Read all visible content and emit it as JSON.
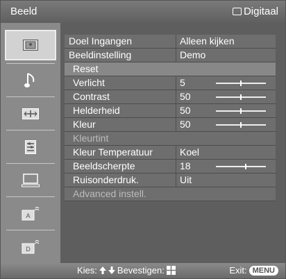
{
  "header": {
    "title": "Beeld",
    "input_label": "Digitaal",
    "input_icon": "tv-input-icon"
  },
  "sidebar": {
    "items": [
      {
        "icon": "picture-icon",
        "selected": true
      },
      {
        "icon": "music-note-icon"
      },
      {
        "icon": "screen-format-icon"
      },
      {
        "icon": "setup-list-icon"
      },
      {
        "icon": "monitor-pc-icon"
      },
      {
        "icon": "analog-setup-icon"
      },
      {
        "icon": "digital-setup-icon"
      }
    ]
  },
  "menu": {
    "rows": [
      {
        "label": "Doel Ingangen",
        "value": "Alleen kijken",
        "level": 0,
        "highlight": false
      },
      {
        "label": "Beeldinstelling",
        "value": "Demo",
        "level": 0,
        "highlight": false
      },
      {
        "label": "Reset",
        "value": "",
        "level": 1,
        "highlight": true
      },
      {
        "label": "Verlicht",
        "value": "5",
        "level": 1,
        "highlight": false,
        "slider": 0.5
      },
      {
        "label": "Contrast",
        "value": "50",
        "level": 1,
        "highlight": false,
        "slider": 0.5
      },
      {
        "label": "Helderheid",
        "value": "50",
        "level": 1,
        "highlight": false,
        "slider": 0.5
      },
      {
        "label": "Kleur",
        "value": "50",
        "level": 1,
        "highlight": false,
        "slider": 0.5
      },
      {
        "label": "Kleurtint",
        "value": "",
        "level": 1,
        "highlight": false,
        "disabled": true
      },
      {
        "label": "Kleur Temperatuur",
        "value": "Koel",
        "level": 1,
        "highlight": false
      },
      {
        "label": "Beeldscherpte",
        "value": "18",
        "level": 1,
        "highlight": false,
        "slider": 0.6
      },
      {
        "label": "Ruisonderdruk.",
        "value": "Uit",
        "level": 1,
        "highlight": false
      },
      {
        "label": "Advanced instell.",
        "value": "",
        "level": 1,
        "highlight": false,
        "disabled": true
      }
    ]
  },
  "footer": {
    "select_label": "Kies:",
    "confirm_label": "Bevestigen:",
    "exit_label": "Exit:",
    "menu_button": "MENU"
  }
}
